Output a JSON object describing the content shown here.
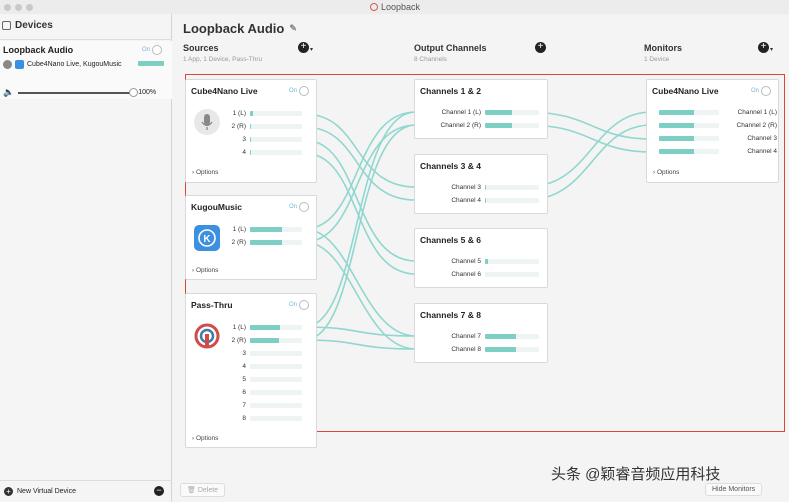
{
  "window": {
    "title": "Loopback"
  },
  "sidebar": {
    "header": "Devices",
    "device": {
      "name": "Loopback Audio",
      "toggle": "On",
      "sources": "Cube4Nano Live, KugouMusic",
      "volume": "100%",
      "volume_fraction": 1.0
    },
    "new_device_label": "New Virtual Device",
    "remove_label": "−"
  },
  "main": {
    "title": "Loopback Audio",
    "columns": {
      "sources": {
        "title": "Sources",
        "subtitle": "1 App, 1 Device, Pass-Thru"
      },
      "outputs": {
        "title": "Output Channels",
        "subtitle": "8 Channels"
      },
      "monitors": {
        "title": "Monitors",
        "subtitle": "1 Device"
      }
    },
    "sources": [
      {
        "name": "Cube4Nano Live",
        "toggle": "On",
        "icon": "microphone-icon",
        "channels": [
          {
            "label": "1 (L)",
            "level": 0.06
          },
          {
            "label": "2 (R)",
            "level": 0.02
          },
          {
            "label": "3",
            "level": 0.01
          },
          {
            "label": "4",
            "level": 0.01
          }
        ],
        "options": "› Options"
      },
      {
        "name": "KugouMusic",
        "toggle": "On",
        "icon": "kugou-icon",
        "channels": [
          {
            "label": "1 (L)",
            "level": 0.62
          },
          {
            "label": "2 (R)",
            "level": 0.62
          }
        ],
        "options": "› Options"
      },
      {
        "name": "Pass-Thru",
        "toggle": "On",
        "icon": "passthru-icon",
        "channels": [
          {
            "label": "1 (L)",
            "level": 0.58
          },
          {
            "label": "2 (R)",
            "level": 0.55
          },
          {
            "label": "3",
            "level": 0
          },
          {
            "label": "4",
            "level": 0
          },
          {
            "label": "5",
            "level": 0
          },
          {
            "label": "6",
            "level": 0
          },
          {
            "label": "7",
            "level": 0
          },
          {
            "label": "8",
            "level": 0
          }
        ],
        "options": "› Options"
      }
    ],
    "outputs": [
      {
        "name": "Channels 1 & 2",
        "channels": [
          {
            "label": "Channel 1 (L)",
            "level": 0.5
          },
          {
            "label": "Channel 2 (R)",
            "level": 0.5
          }
        ]
      },
      {
        "name": "Channels 3 & 4",
        "channels": [
          {
            "label": "Channel 3",
            "level": 0.01
          },
          {
            "label": "Channel 4",
            "level": 0.01
          }
        ]
      },
      {
        "name": "Channels 5 & 6",
        "channels": [
          {
            "label": "Channel 5",
            "level": 0.05
          },
          {
            "label": "Channel 6",
            "level": 0.0
          }
        ]
      },
      {
        "name": "Channels 7 & 8",
        "channels": [
          {
            "label": "Channel 7",
            "level": 0.58
          },
          {
            "label": "Channel 8",
            "level": 0.58
          }
        ]
      }
    ],
    "monitor": {
      "name": "Cube4Nano Live",
      "toggle": "On",
      "channels": [
        {
          "label": "Channel 1 (L)",
          "level": 0.58
        },
        {
          "label": "Channel 2 (R)",
          "level": 0.58
        },
        {
          "label": "Channel 3",
          "level": 0.58
        },
        {
          "label": "Channel 4",
          "level": 0.58
        }
      ],
      "options": "› Options"
    },
    "delete_label": "Delete",
    "hide_monitors_label": "Hide Monitors"
  },
  "watermark": "头条 @颖睿音频应用科技",
  "colors": {
    "accent": "#7dcfc4",
    "highlight_box": "#d9463e",
    "toggle_text": "#6fb9d6"
  }
}
